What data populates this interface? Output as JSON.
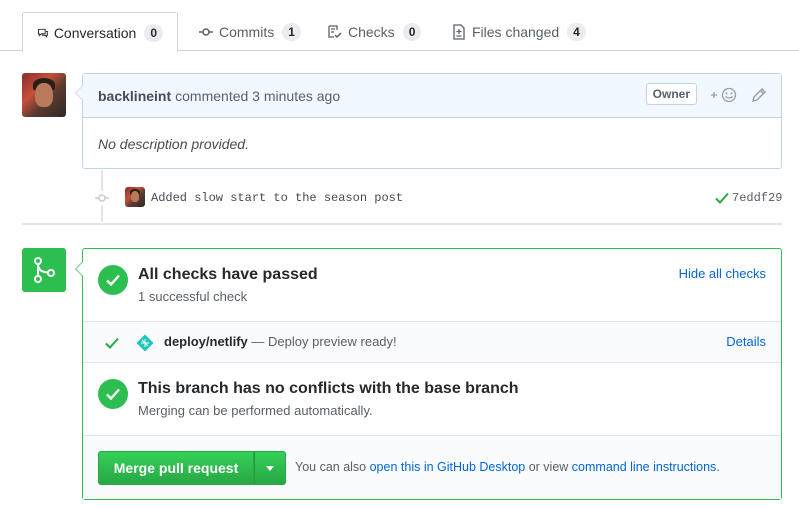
{
  "tabs": [
    {
      "label": "Conversation",
      "count": "0"
    },
    {
      "label": "Commits",
      "count": "1"
    },
    {
      "label": "Checks",
      "count": "0"
    },
    {
      "label": "Files changed",
      "count": "4"
    }
  ],
  "comment": {
    "author": "backlineint",
    "action": "commented 3 minutes ago",
    "badge": "Owner",
    "reaction_label": "+",
    "body": "No description provided."
  },
  "commit": {
    "message": "Added slow start to the season post",
    "sha": "7eddf29"
  },
  "merge": {
    "checks_title": "All checks have passed",
    "checks_sub": "1 successful check",
    "hide_checks": "Hide all checks",
    "check_name": "deploy/netlify",
    "check_desc": " — Deploy preview ready!",
    "details": "Details",
    "conflict_title": "This branch has no conflicts with the base branch",
    "conflict_sub": "Merging can be performed automatically.",
    "merge_button": "Merge pull request",
    "note_prefix": "You can also ",
    "note_link1": "open this in GitHub Desktop",
    "note_middle": " or view ",
    "note_link2": "command line instructions",
    "note_suffix": "."
  },
  "colors": {
    "success": "#2cbe4e",
    "link": "#0366d6",
    "header_bg": "#f1f8ff",
    "netlify": "#20c6b7"
  },
  "icons": {
    "conversation": "comment-discussion-icon",
    "commits": "git-commit-icon",
    "checks": "checklist-icon",
    "files": "file-diff-icon",
    "merge": "git-merge-icon"
  }
}
